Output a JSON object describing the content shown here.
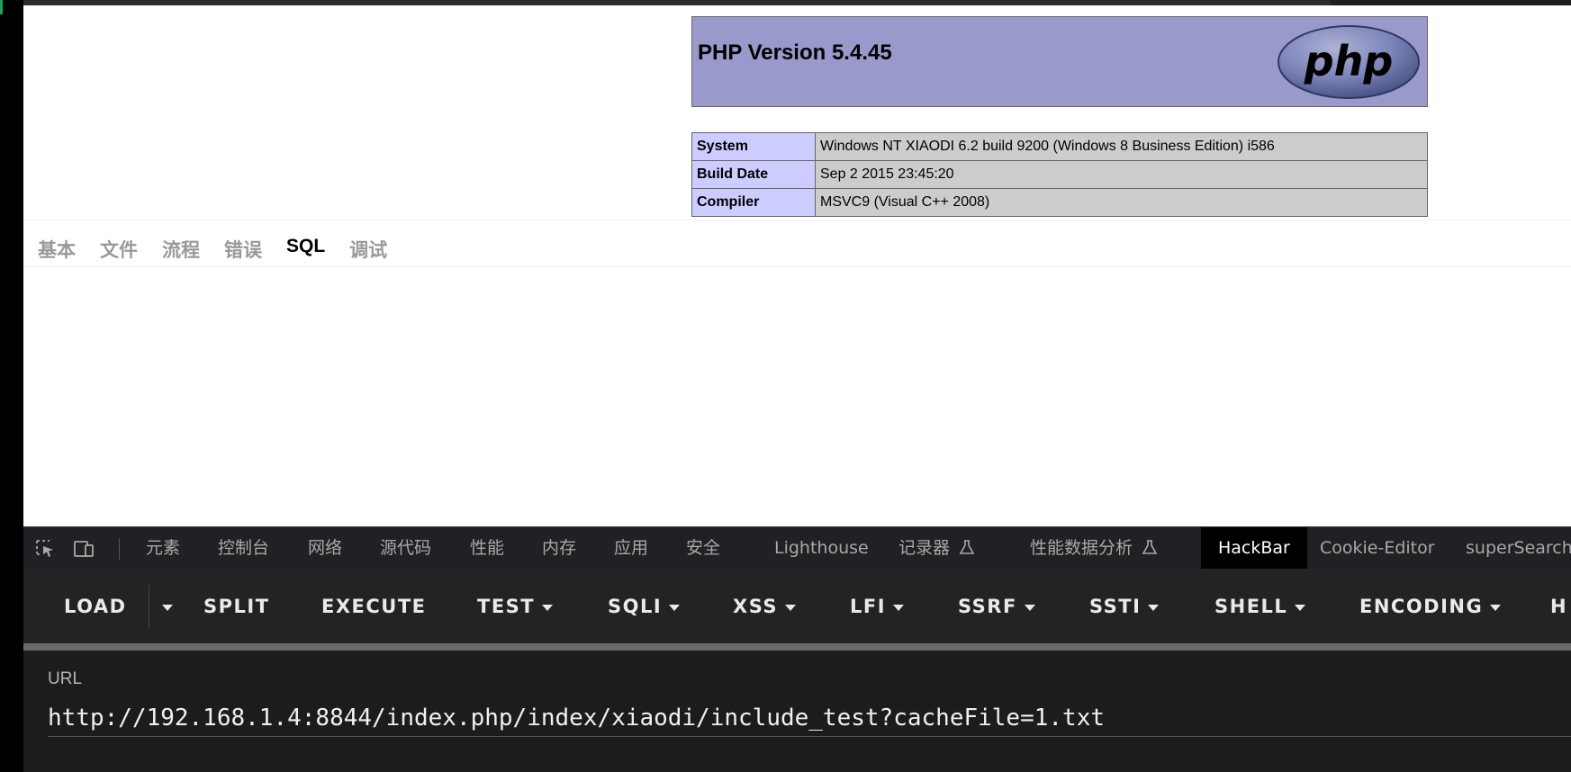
{
  "phpinfo": {
    "title": "PHP Version 5.4.45",
    "logo_text": "php",
    "rows": [
      {
        "key": "System",
        "value": "Windows NT XIAODI 6.2 build 9200 (Windows 8 Business Edition) i586"
      },
      {
        "key": "Build Date",
        "value": "Sep 2 2015 23:45:20"
      },
      {
        "key": "Compiler",
        "value": "MSVC9 (Visual C++ 2008)"
      }
    ]
  },
  "trace": {
    "tabs": [
      "基本",
      "文件",
      "流程",
      "错误",
      "SQL",
      "调试"
    ],
    "active": "SQL"
  },
  "devtools": {
    "tabs": [
      "元素",
      "控制台",
      "网络",
      "源代码",
      "性能",
      "内存",
      "应用",
      "安全",
      "Lighthouse",
      "记录器",
      "性能数据分析",
      "HackBar",
      "Cookie-Editor",
      "superSearchP"
    ],
    "active": "HackBar"
  },
  "hackbar": {
    "items": [
      "LOAD",
      "SPLIT",
      "EXECUTE",
      "TEST",
      "SQLI",
      "XSS",
      "LFI",
      "SSRF",
      "SSTI",
      "SHELL",
      "ENCODING",
      "H"
    ],
    "url_label": "URL",
    "url_value": "http://192.168.1.4:8844/index.php/index/xiaodi/include_test?cacheFile=1.txt"
  },
  "colors": {
    "php_header": "#9999cc",
    "php_key_cell": "#ccccff",
    "php_value_cell": "#cccccc",
    "devtools_bg": "#202124",
    "hackbar_bg": "#232323"
  }
}
